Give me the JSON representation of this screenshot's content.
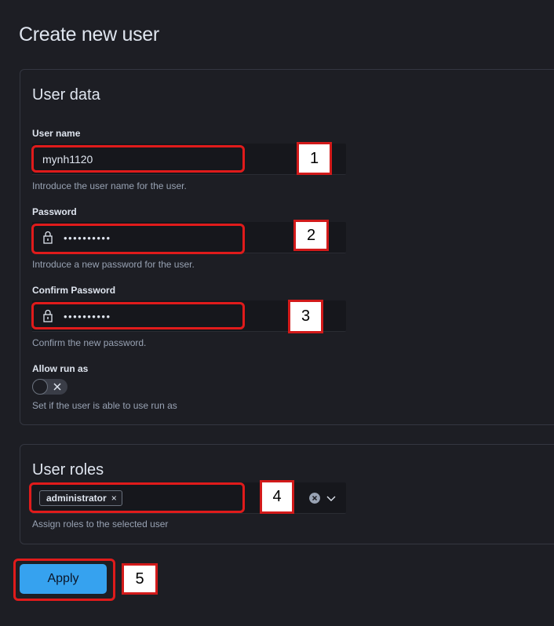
{
  "page": {
    "title": "Create new user"
  },
  "user_data": {
    "title": "User data",
    "username": {
      "label": "User name",
      "value": "mynh1120",
      "help": "Introduce the user name for the user."
    },
    "password": {
      "label": "Password",
      "masked": "••••••••••",
      "help": "Introduce a new password for the user."
    },
    "confirm_password": {
      "label": "Confirm Password",
      "masked": "••••••••••",
      "help": "Confirm the new password."
    },
    "allow_run_as": {
      "label": "Allow run as",
      "checked": false,
      "help": "Set if the user is able to use run as"
    }
  },
  "user_roles": {
    "title": "User roles",
    "selected": [
      "administrator"
    ],
    "remove_glyph": "×",
    "help": "Assign roles to the selected user"
  },
  "apply_label": "Apply",
  "annotations": [
    "1",
    "2",
    "3",
    "4",
    "5"
  ],
  "colors": {
    "annotation": "#e01b1b",
    "primary_button": "#36a2ef",
    "background": "#1d1e24"
  },
  "icons": [
    "lock-icon",
    "toggle-cross-icon",
    "chip-remove-icon",
    "clear-icon",
    "chevron-down-icon"
  ]
}
